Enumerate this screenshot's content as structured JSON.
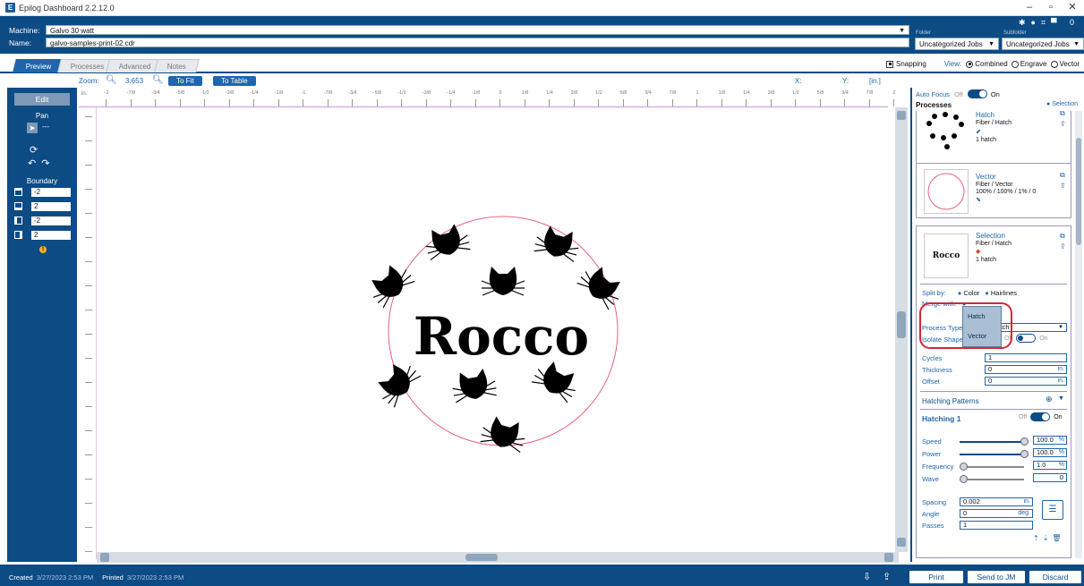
{
  "window": {
    "title": "Epilog Dashboard 2.2.12.0",
    "controls": [
      "minimize",
      "maximize",
      "close"
    ]
  },
  "header": {
    "machine_label": "Machine:",
    "machine_value": "Galvo 30 watt",
    "name_label": "Name:",
    "name_value": "galvo-samples-print-02.cdr",
    "folder_label": "Folder",
    "folder_value": "Uncategorized Jobs",
    "subfolder_label": "Subfolder",
    "subfolder_value": "Uncategorized Jobs",
    "top_right_count": "0"
  },
  "tabs": [
    {
      "label": "Preview",
      "active": true
    },
    {
      "label": "Processes",
      "active": false
    },
    {
      "label": "Advanced",
      "active": false
    },
    {
      "label": "Notes",
      "active": false
    }
  ],
  "view_options": {
    "snapping_label": "Snapping",
    "snapping_checked": true,
    "view_label": "View:",
    "modes": [
      {
        "label": "Combined",
        "selected": true
      },
      {
        "label": "Engrave",
        "selected": false
      },
      {
        "label": "Vector",
        "selected": false
      }
    ]
  },
  "zoom": {
    "label": "Zoom:",
    "value": "3.653",
    "to_fit": "To Fit",
    "to_table": "To Table",
    "x_label": "X:",
    "y_label": "Y:",
    "unit": "[in.]"
  },
  "ruler": {
    "corner": "in.",
    "top_labels": [
      "-2",
      "-7/8",
      "-3/4",
      "-5/8",
      "-1/2",
      "-3/8",
      "-1/4",
      "-1/8",
      "-1",
      "-7/8",
      "-3/4",
      "-5/8",
      "-1/2",
      "-3/8",
      "-1/4",
      "-1/8",
      "0",
      "1/8",
      "1/4",
      "3/8",
      "1/2",
      "5/8",
      "3/4",
      "7/8",
      "1",
      "1/8",
      "1/4",
      "3/8",
      "1/2",
      "5/8",
      "3/4",
      "7/8",
      "2"
    ]
  },
  "left_panel": {
    "edit": "Edit",
    "pan": "Pan",
    "boundary_label": "Boundary",
    "boundary_values": [
      "-2",
      "2",
      "-2",
      "2"
    ]
  },
  "canvas": {
    "design_text": "Rocco",
    "design_color": "#e8637d"
  },
  "right_panel": {
    "auto_focus_label": "Auto Focus",
    "auto_focus_off": "Off",
    "auto_focus_on": "On",
    "processes_label": "Processes",
    "selection_link": "Selection",
    "cards": [
      {
        "title": "Hatch",
        "line1": "Fiber / Hatch",
        "line2": "",
        "count": "1 hatch"
      },
      {
        "title": "Vector",
        "line1": "Fiber / Vector",
        "line2": "100% / 100% / 1% / 0",
        "count": ""
      },
      {
        "title": "Selection",
        "line1": "Fiber / Hatch",
        "line2": "",
        "count": "1 hatch",
        "thumb_text": "Rocco"
      }
    ],
    "split_by_label": "Split by:",
    "split_color": "Color",
    "split_hairlines": "Hairlines",
    "merge_with_label": "Merge with:",
    "process_type_label": "Process Type",
    "process_type_value": "Hatch",
    "isolate_label": "Isolate Shapes",
    "isolate_off": "Off",
    "isolate_on": "On",
    "dropdown_options": [
      "Hatch",
      "Vector"
    ],
    "cycles_label": "Cycles",
    "cycles_value": "1",
    "thickness_label": "Thickness",
    "thickness_value": "0",
    "offset_label": "Offset",
    "offset_value": "0",
    "unit_in": "in.",
    "hatching_patterns_label": "Hatching Patterns",
    "hatching1_label": "Hatching 1",
    "hatching_off": "Off",
    "hatching_on": "On",
    "speed_label": "Speed",
    "speed_value": "100.0",
    "power_label": "Power",
    "power_value": "100.0",
    "frequency_label": "Frequency",
    "frequency_value": "1.0",
    "wave_label": "Wave",
    "wave_value": "0",
    "percent": "%",
    "spacing_label": "Spacing",
    "spacing_value": "0.002",
    "angle_label": "Angle",
    "angle_value": "0",
    "angle_unit": "deg.",
    "passes_label": "Passes",
    "passes_value": "1",
    "speed_level": 1.0,
    "power_level": 1.0,
    "frequency_level": 0.0,
    "wave_level": 0.0
  },
  "status_bar": {
    "created_label": "Created",
    "created_value": "3/27/2023 2:53 PM",
    "printed_label": "Printed",
    "printed_value": "3/27/2023 2:53 PM",
    "print_button": "Print",
    "send_button": "Send to JM",
    "discard_button": "Discard"
  },
  "colors": {
    "brand": "#0d4b85",
    "accent": "#1f66ad",
    "highlight": "#d9243a"
  }
}
